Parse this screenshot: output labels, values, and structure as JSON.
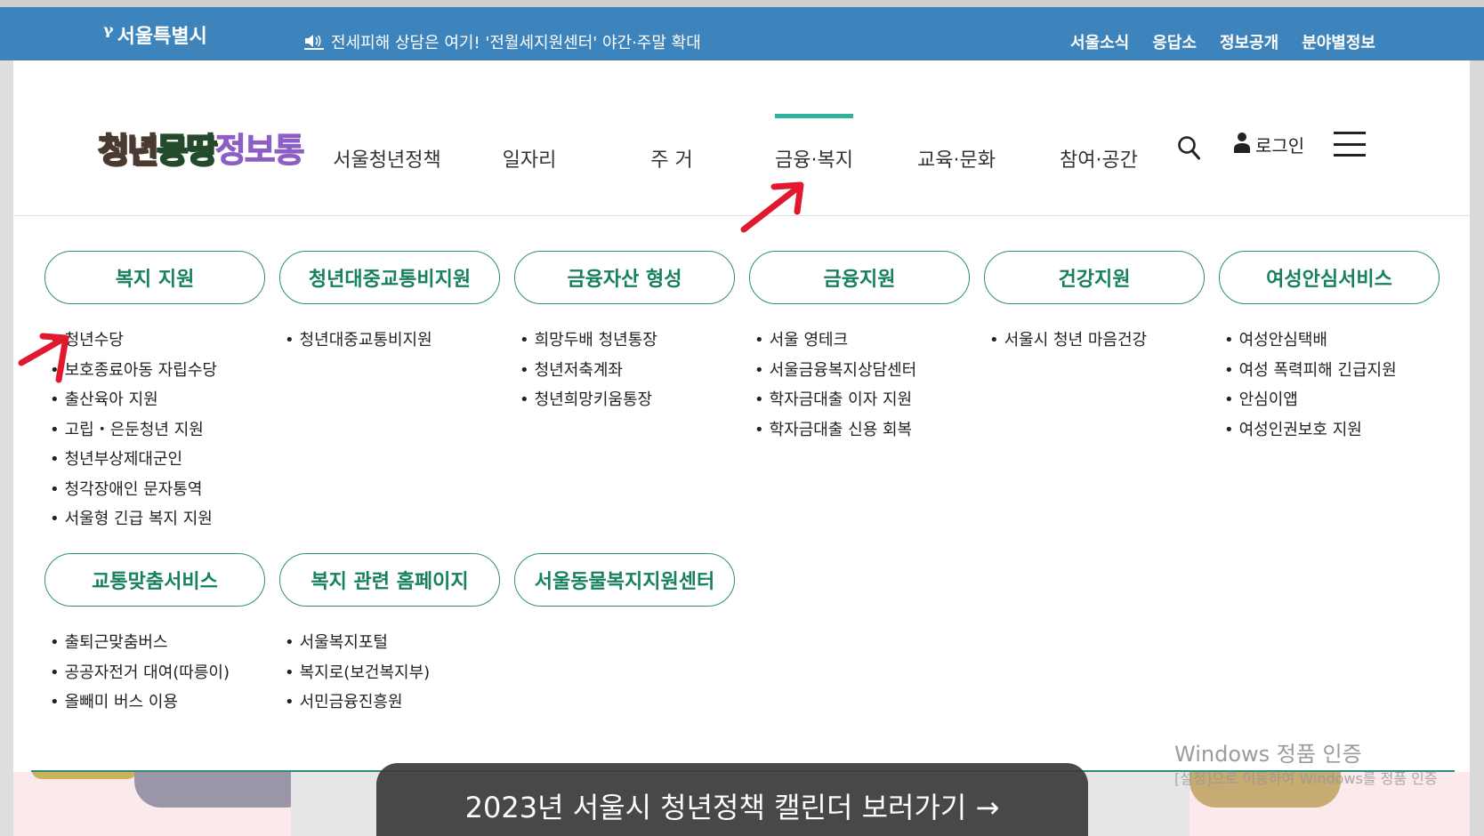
{
  "topbar": {
    "seal_text": "서울특별시",
    "notice": "전세피해 상담은 여기! '전월세지원센터' 야간·주말 확대",
    "links": [
      "서울소식",
      "응답소",
      "정보공개",
      "분야별정보"
    ]
  },
  "header": {
    "logo": {
      "part1": "청년",
      "part2": "몽땅",
      "part3": "정보통"
    },
    "nav": [
      {
        "label": "서울청년정책",
        "active": false
      },
      {
        "label": "일자리",
        "active": false
      },
      {
        "label": "주 거",
        "active": false
      },
      {
        "label": "금융·복지",
        "active": true
      },
      {
        "label": "교육·문화",
        "active": false
      },
      {
        "label": "참여·공간",
        "active": false
      }
    ],
    "login_label": "로그인"
  },
  "mega_menu": {
    "row1": [
      {
        "title": "복지 지원",
        "items": [
          "청년수당",
          "보호종료아동 자립수당",
          "출산육아 지원",
          "고립・은둔청년 지원",
          "청년부상제대군인",
          "청각장애인 문자통역",
          "서울형 긴급 복지 지원"
        ]
      },
      {
        "title": "청년대중교통비지원",
        "items": [
          "청년대중교통비지원"
        ]
      },
      {
        "title": "금융자산 형성",
        "items": [
          "희망두배 청년통장",
          "청년저축계좌",
          "청년희망키움통장"
        ]
      },
      {
        "title": "금융지원",
        "items": [
          "서울 영테크",
          "서울금융복지상담센터",
          "학자금대출 이자 지원",
          "학자금대출 신용 회복"
        ]
      },
      {
        "title": "건강지원",
        "items": [
          "서울시 청년 마음건강"
        ]
      },
      {
        "title": "여성안심서비스",
        "items": [
          "여성안심택배",
          "여성 폭력피해 긴급지원",
          "안심이앱",
          "여성인권보호 지원"
        ]
      }
    ],
    "row2": [
      {
        "title": "교통맞춤서비스",
        "items": [
          "출퇴근맞춤버스",
          "공공자전거 대여(따릉이)",
          "올빼미 버스 이용"
        ]
      },
      {
        "title": "복지 관련 홈페이지",
        "items": [
          "서울복지포털",
          "복지로(보건복지부)",
          "서민금융진흥원"
        ]
      },
      {
        "title": "서울동물복지지원센터",
        "items": []
      }
    ]
  },
  "banner": {
    "cta": "2023년 서울시 청년정책 캘린더 보러가기 →"
  },
  "watermark": {
    "line1": "Windows 정품 인증",
    "line2": "[설정]으로 이동하여 Windows를 정품 인증"
  },
  "colors": {
    "topbar": "#3d84bd",
    "accent": "#2eb39a",
    "pill_text": "#17805f",
    "annotation": "#e0192e"
  }
}
